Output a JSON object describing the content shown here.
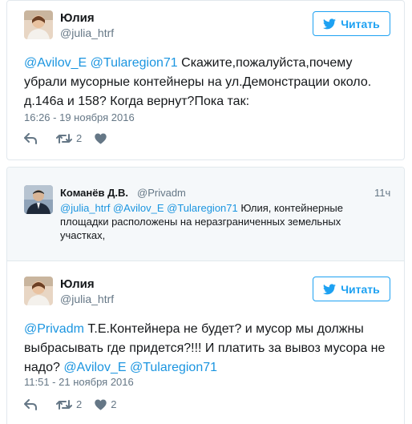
{
  "tweet1": {
    "name": "Юлия",
    "handle": "@julia_htrf",
    "follow_label": "Читать",
    "text_parts": [
      {
        "t": "@Avilov_E",
        "m": true
      },
      {
        "t": " ",
        "m": false
      },
      {
        "t": "@Tularegion71",
        "m": true
      },
      {
        "t": " Скажите,пожалуйста,почему убрали мусорные контейнеры на ул.Демонстрации около. д.146а и 158? Когда вернут?Пока так:",
        "m": false
      }
    ],
    "timestamp": "16:26 - 19 ноября 2016",
    "retweets": "2",
    "likes": ""
  },
  "quote": {
    "name": "Команёв Д.В.",
    "handle": "@Privadm",
    "time": "11ч",
    "text_parts": [
      {
        "t": "@julia_htrf",
        "m": true
      },
      {
        "t": " ",
        "m": false
      },
      {
        "t": "@Avilov_E",
        "m": true
      },
      {
        "t": " ",
        "m": false
      },
      {
        "t": "@Tularegion71",
        "m": true
      },
      {
        "t": " Юлия, контейнерные площадки расположены на неразграниченных земельных участках,",
        "m": false
      }
    ]
  },
  "tweet2": {
    "name": "Юлия",
    "handle": "@julia_htrf",
    "follow_label": "Читать",
    "text_parts": [
      {
        "t": "@Privadm",
        "m": true
      },
      {
        "t": " Т.Е.Контейнера не будет? и мусор мы должны выбрасывать где придется?!!! И платить за вывоз мусора не надо? ",
        "m": false
      },
      {
        "t": "@Avilov_E",
        "m": true
      },
      {
        "t": " ",
        "m": false
      },
      {
        "t": "@Tularegion71",
        "m": true
      }
    ],
    "timestamp": "11:51 - 21 ноября 2016",
    "retweets": "2",
    "likes": "2"
  },
  "icons": {
    "follow": "twitter-bird-icon",
    "reply": "reply-icon",
    "retweet": "retweet-icon",
    "like": "heart-icon"
  },
  "colors": {
    "link": "#1b95e0",
    "brand": "#1da1f2",
    "muted": "#657786",
    "border": "#e1e8ed",
    "quote_bg": "#f5f8fa"
  }
}
